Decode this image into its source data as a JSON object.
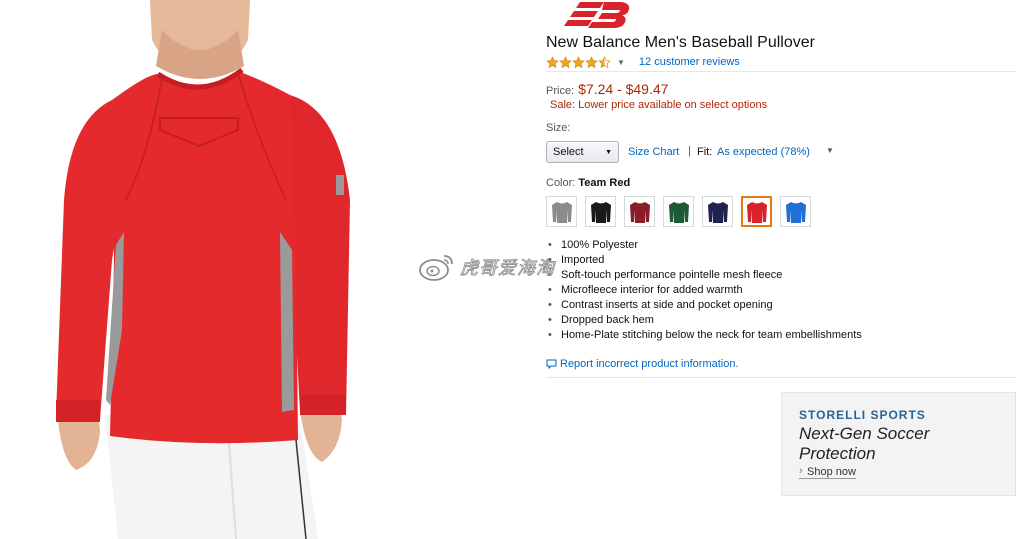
{
  "brand_logo": "NB",
  "product": {
    "title": "New Balance Men's Baseball Pullover",
    "rating": 4.5,
    "reviews_link": "12 customer reviews"
  },
  "price": {
    "label": "Price:",
    "value": "$7.24 - $49.47",
    "sale_text": "Sale: Lower price available on select options"
  },
  "size": {
    "label": "Size:",
    "selected": "Select",
    "size_chart_link": "Size Chart",
    "separator": "|",
    "fit_label": "Fit:",
    "fit_value": "As expected (78%)"
  },
  "color": {
    "label": "Color:",
    "selected_name": "Team Red",
    "swatches": [
      {
        "name": "gray",
        "hex": "#8a8c8a"
      },
      {
        "name": "black",
        "hex": "#1a1a1a"
      },
      {
        "name": "maroon",
        "hex": "#8b1c2c"
      },
      {
        "name": "dark-green",
        "hex": "#1f5a35"
      },
      {
        "name": "navy",
        "hex": "#1f2350"
      },
      {
        "name": "team-red",
        "hex": "#d8232a"
      },
      {
        "name": "royal-blue",
        "hex": "#1f6fd6"
      }
    ],
    "selected_index": 5
  },
  "features": [
    "100% Polyester",
    "Imported",
    "Soft-touch performance pointelle mesh fleece",
    "Microfleece interior for added warmth",
    "Contrast inserts at side and pocket opening",
    "Dropped back hem",
    "Home-Plate stitching below the neck for team embellishments"
  ],
  "report_link": "Report incorrect product information.",
  "ad": {
    "brand": "STORELLI SPORTS",
    "headline": "Next-Gen Soccer Protection",
    "cta": "Shop now"
  },
  "watermark": "虎哥爱海淘",
  "colors": {
    "price_red": "#b12704",
    "link_blue": "#0066c0",
    "shirt_red": "#e52a2e",
    "insert_gray": "#9a9a9a"
  }
}
